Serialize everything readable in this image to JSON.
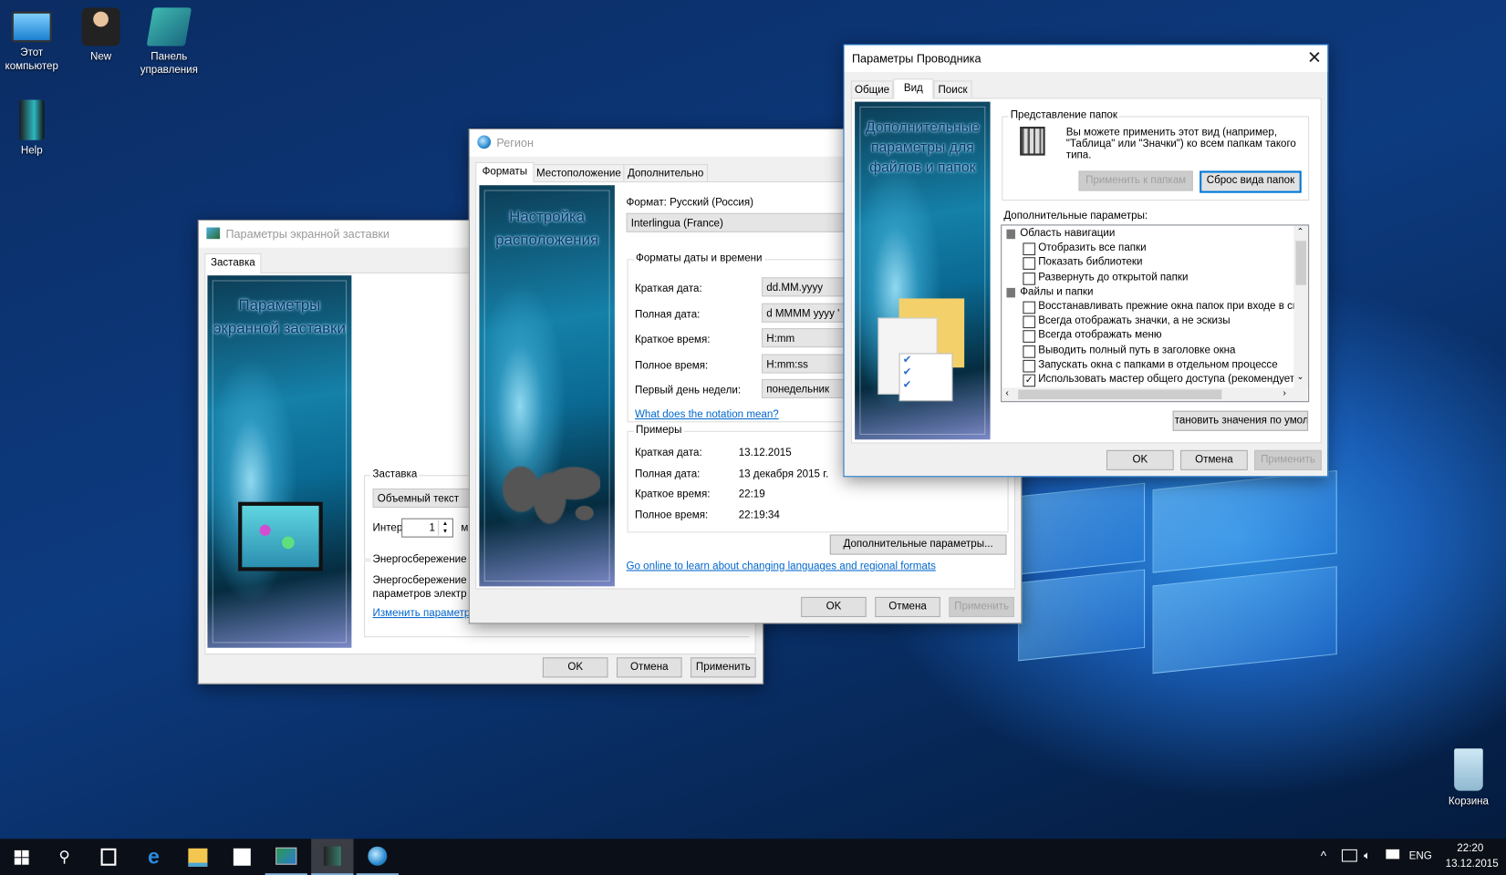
{
  "desktop": {
    "icons": [
      {
        "label": "Этот компьютер"
      },
      {
        "label": "New"
      },
      {
        "label": "Панель управления"
      },
      {
        "label": "Help"
      },
      {
        "label": "Корзина"
      }
    ]
  },
  "screensaver": {
    "title": "Параметры экранной заставки",
    "tab": "Заставка",
    "art_caption": "Параметры экранной заставки",
    "group_screensaver": "Заставка",
    "screensaver_value": "Объемный текст",
    "interval_label": "Интер",
    "interval_value": "1",
    "interval_unit": "м",
    "group_power": "Энергосбережение",
    "power_text_1": "Энергосбережение",
    "power_text_2": "параметров электр",
    "power_link": "Изменить параметр",
    "ok": "OK",
    "cancel": "Отмена",
    "apply": "Применить"
  },
  "region": {
    "title": "Регион",
    "tabs": [
      "Форматы",
      "Местоположение",
      "Дополнительно"
    ],
    "active_tab": "Форматы",
    "art_caption": "Настройка расположения",
    "format_label": "Формат: Русский (Россия)",
    "format_value": "Interlingua (France)",
    "group_formats": "Форматы даты и времени",
    "formats": [
      {
        "label": "Краткая дата:",
        "value": "dd.MM.yyyy"
      },
      {
        "label": "Полная дата:",
        "value": "d MMMM yyyy '"
      },
      {
        "label": "Краткое время:",
        "value": "H:mm"
      },
      {
        "label": "Полное время:",
        "value": "H:mm:ss"
      },
      {
        "label": "Первый день недели:",
        "value": "понедельник"
      }
    ],
    "notation_link": "What does the notation mean?",
    "group_examples": "Примеры",
    "examples": [
      {
        "label": "Краткая дата:",
        "value": "13.12.2015"
      },
      {
        "label": "Полная дата:",
        "value": "13 декабря 2015 г."
      },
      {
        "label": "Краткое время:",
        "value": "22:19"
      },
      {
        "label": "Полное время:",
        "value": "22:19:34"
      }
    ],
    "additional_button": "Дополнительные параметры...",
    "online_link": "Go online to learn about changing languages and regional formats",
    "ok": "OK",
    "cancel": "Отмена",
    "apply": "Применить"
  },
  "explorer": {
    "title": "Параметры Проводника",
    "tabs": [
      "Общие",
      "Вид",
      "Поиск"
    ],
    "active_tab": "Вид",
    "art_caption": "Дополнительные параметры для файлов и папок",
    "group_folder_view": "Представление папок",
    "folder_view_text": "Вы можете применить этот вид (например, \"Таблица\" или \"Значки\") ко всем папкам такого типа.",
    "apply_to_folders": "Применить к папкам",
    "reset_folders": "Сброс вида папок",
    "advanced_label": "Дополнительные параметры:",
    "tree": [
      {
        "type": "category",
        "label": "Область навигации"
      },
      {
        "type": "check",
        "label": "Отобразить все папки",
        "checked": false
      },
      {
        "type": "check",
        "label": "Показать библиотеки",
        "checked": false
      },
      {
        "type": "check",
        "label": "Развернуть до открытой папки",
        "checked": false
      },
      {
        "type": "category",
        "label": "Файлы и папки"
      },
      {
        "type": "check",
        "label": "Восстанавливать прежние окна папок при входе в сис",
        "checked": false
      },
      {
        "type": "check",
        "label": "Всегда отображать значки, а не эскизы",
        "checked": false
      },
      {
        "type": "check",
        "label": "Всегда отображать меню",
        "checked": false
      },
      {
        "type": "check",
        "label": "Выводить полный путь в заголовке окна",
        "checked": false
      },
      {
        "type": "check",
        "label": "Запускать окна с папками в отдельном процессе",
        "checked": false
      },
      {
        "type": "check",
        "label": "Использовать мастер общего доступа (рекомендуется",
        "checked": true
      }
    ],
    "restore_defaults": "тановить значения по умолча",
    "ok": "OK",
    "cancel": "Отмена",
    "apply": "Применить"
  },
  "taskbar": {
    "items": [
      "start-icon",
      "search-icon",
      "task-view-icon",
      "edge-icon",
      "file-explorer-icon",
      "store-icon",
      "screensaver-settings-icon",
      "folder-options-icon",
      "region-icon"
    ],
    "tray": {
      "language": "ENG",
      "time": "22:20",
      "date": "13.12.2015"
    }
  }
}
